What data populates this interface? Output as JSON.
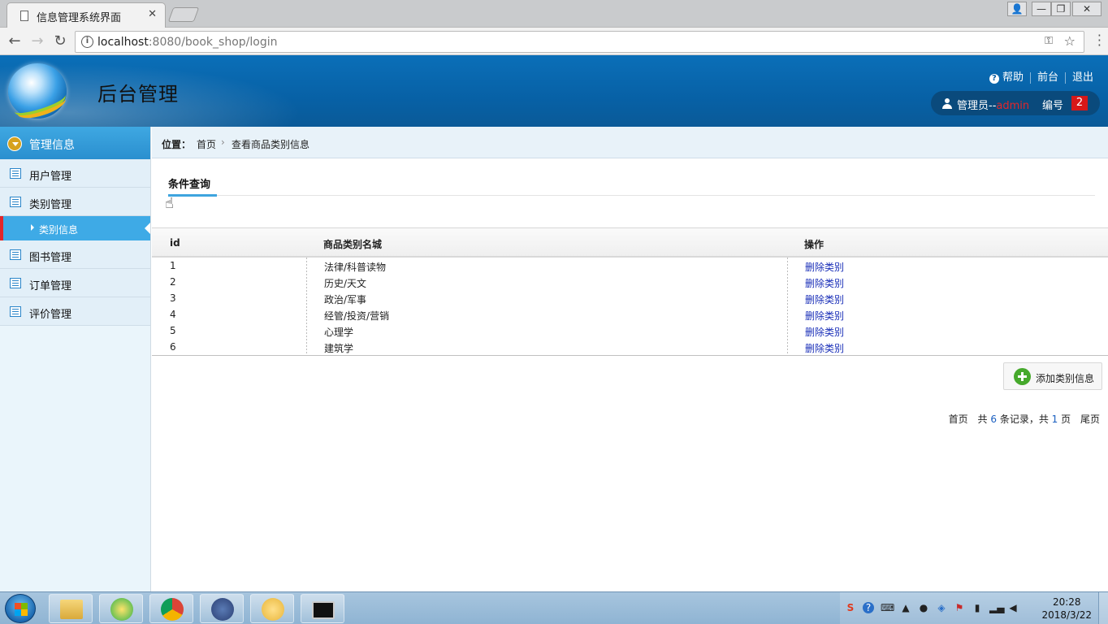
{
  "browser": {
    "tab_title": "信息管理系统界面",
    "tab_close": "✕",
    "url_host": "localhost",
    "url_rest": ":8080/book_shop/login",
    "win_controls": [
      "👤",
      "—",
      "❐",
      "✕"
    ]
  },
  "header": {
    "title": "后台管理",
    "links": {
      "help": "帮助",
      "front": "前台",
      "logout": "退出"
    },
    "user": {
      "role_prefix": "管理员--",
      "name": "admin",
      "num_label": "编号",
      "num": "2"
    }
  },
  "sidebar": {
    "title": "管理信息",
    "items": [
      {
        "label": "用户管理"
      },
      {
        "label": "类别管理"
      },
      {
        "label": "图书管理"
      },
      {
        "label": "订单管理"
      },
      {
        "label": "评价管理"
      }
    ],
    "active_sub": "类别信息"
  },
  "breadcrumb": {
    "label": "位置：",
    "home": "首页",
    "sep": "›",
    "current": "查看商品类别信息"
  },
  "query": {
    "tab_label": "条件查询"
  },
  "table": {
    "headers": {
      "id": "id",
      "name": "商品类别名城",
      "ops": "操作"
    },
    "rows": [
      {
        "id": "1",
        "name": "法律/科普读物",
        "op": "删除类别"
      },
      {
        "id": "2",
        "name": "历史/天文",
        "op": "删除类别"
      },
      {
        "id": "3",
        "name": "政治/军事",
        "op": "删除类别"
      },
      {
        "id": "4",
        "name": "经管/投资/营销",
        "op": "删除类别"
      },
      {
        "id": "5",
        "name": "心理学",
        "op": "删除类别"
      },
      {
        "id": "6",
        "name": "建筑学",
        "op": "删除类别"
      }
    ]
  },
  "actions": {
    "add_label": "添加类别信息"
  },
  "pager": {
    "first": "首页",
    "total_prefix": "共",
    "total": "6",
    "total_suffix": "条记录，共",
    "pages": "1",
    "pages_suffix": "页",
    "last": "尾页"
  },
  "taskbar": {
    "time": "20:28",
    "date": "2018/3/22"
  },
  "colors": {
    "header_blue": "#0761a6",
    "sidebar_active": "#3eaae6",
    "active_marker": "#e2262a",
    "link_blue": "#1a2fb8",
    "add_green": "#46a92c"
  }
}
